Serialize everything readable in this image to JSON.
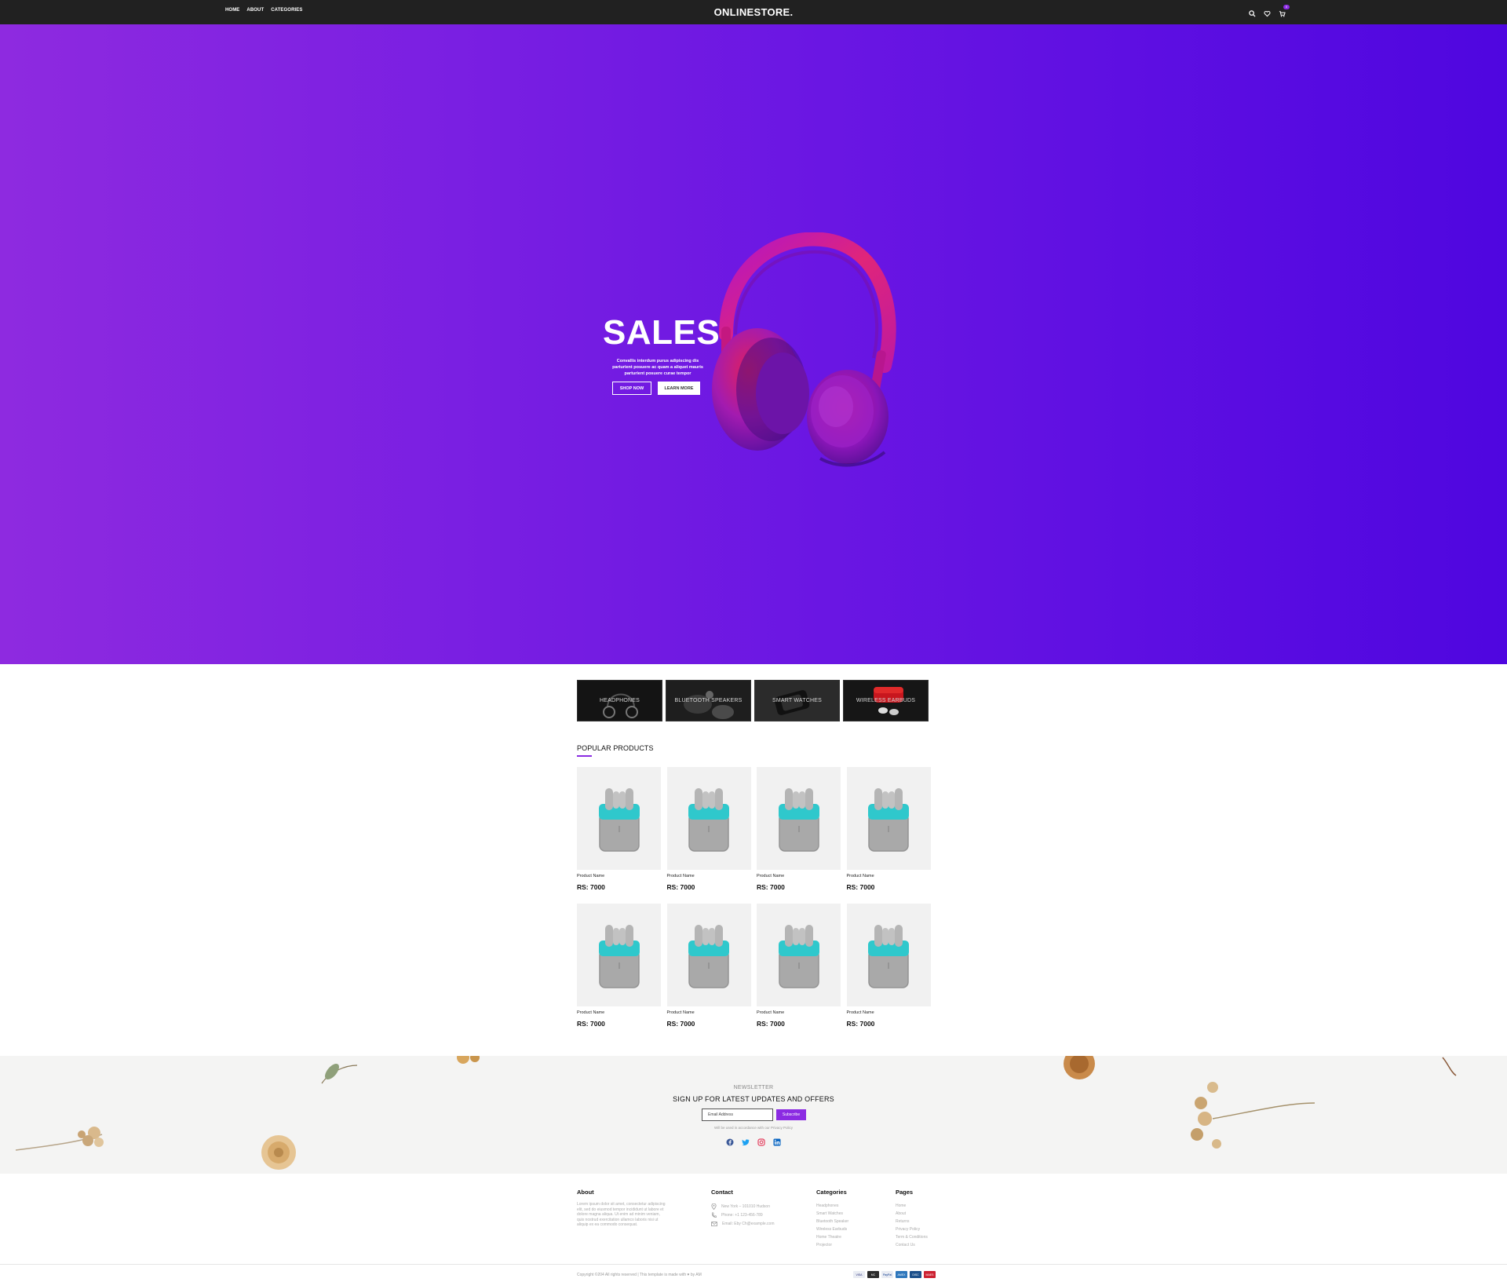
{
  "header": {
    "nav": [
      "HOME",
      "ABOUT",
      "CATEGORIES"
    ],
    "logo": "ONLINESTORE.",
    "cart_count": "0"
  },
  "hero": {
    "title": "SALES",
    "description": "Convallis interdum purus adipiscing dis parturient posuere ac quam a aliquet mauris parturient posuere curae tempor",
    "primary_button": "SHOP NOW",
    "secondary_button": "LEARN MORE"
  },
  "categories": [
    "HEADPHONES",
    "BLUETOOTH SPEAKERS",
    "SMART WATCHES",
    "WIRELESS EARBUDS"
  ],
  "popular": {
    "title": "POPULAR PRODUCTS",
    "products": [
      {
        "name": "Product Name",
        "price": "RS: 7000"
      },
      {
        "name": "Product Name",
        "price": "RS: 7000"
      },
      {
        "name": "Product Name",
        "price": "RS: 7000"
      },
      {
        "name": "Product Name",
        "price": "RS: 7000"
      },
      {
        "name": "Product Name",
        "price": "RS: 7000"
      },
      {
        "name": "Product Name",
        "price": "RS: 7000"
      },
      {
        "name": "Product Name",
        "price": "RS: 7000"
      },
      {
        "name": "Product Name",
        "price": "RS: 7000"
      }
    ]
  },
  "newsletter": {
    "label": "NEWSLETTER",
    "title": "SIGN UP FOR LATEST UPDATES AND OFFERS",
    "placeholder": "Email Address",
    "button": "Subscribe",
    "note": "Will be used in accordance with our Privacy Policy",
    "social": [
      "facebook-icon",
      "twitter-icon",
      "instagram-icon",
      "linkedin-icon"
    ]
  },
  "footer": {
    "about": {
      "title": "About",
      "text": "Lorem ipsum dolor sit amet, consectetur adipiscing elit, sed do eiusmod tempor incididunt ut labore et dolore magna aliqua. Ut enim ad minim veniam, quis nostrud exercitation ullamco laboris nisi ut aliquip ex ea commodo consequat."
    },
    "contact": {
      "title": "Contact",
      "address": "New York – 101010 Hudson",
      "phone": "Phone: +1 123-456-789",
      "email": "Email: Eby Ch@example.com"
    },
    "categories": {
      "title": "Categories",
      "links": [
        "Headphones",
        "Smart Watches",
        "Bluetooth Speaker",
        "Wireless Earbuds",
        "Home Theatre",
        "Projector"
      ]
    },
    "pages": {
      "title": "Pages",
      "links": [
        "Home",
        "About",
        "Returns",
        "Privacy Policy",
        "Term & Conditions",
        "Contact Us"
      ]
    },
    "copyright": "Copyright ©204 All rights reserved | This template is made with ♥ by AM",
    "payments": [
      "VISA",
      "MC",
      "PayPal",
      "AMEX",
      "DISC",
      "MAES"
    ]
  }
}
